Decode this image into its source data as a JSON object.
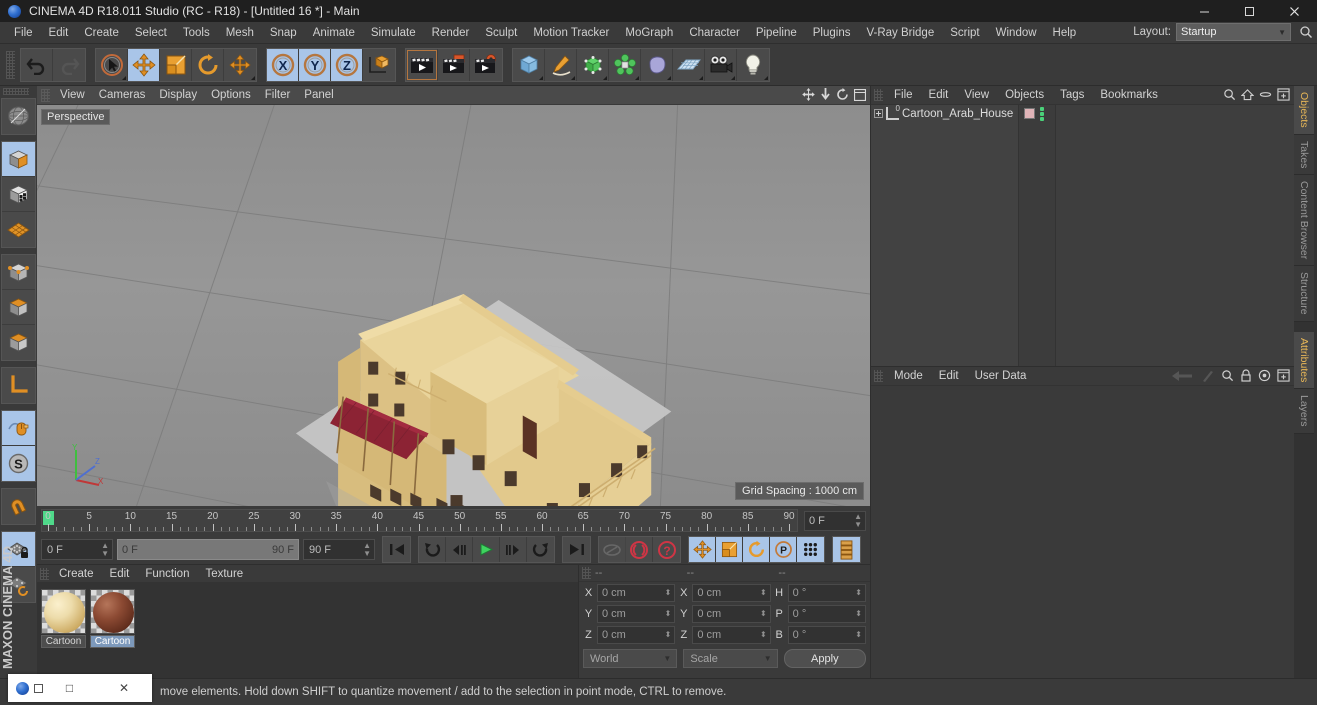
{
  "window": {
    "title": "CINEMA 4D R18.011 Studio (RC - R18) - [Untitled 16 *] - Main",
    "minimize": "─",
    "maximize": "❐",
    "close": "✕"
  },
  "menubar": {
    "items": [
      "File",
      "Edit",
      "Create",
      "Select",
      "Tools",
      "Mesh",
      "Snap",
      "Animate",
      "Simulate",
      "Render",
      "Sculpt",
      "Motion Tracker",
      "MoGraph",
      "Character",
      "Pipeline",
      "Plugins",
      "V-Ray Bridge",
      "Script",
      "Window",
      "Help"
    ],
    "layout_label": "Layout:",
    "layout_value": "Startup"
  },
  "toolbar": {
    "groups": [
      {
        "name": "history",
        "buttons": [
          {
            "name": "undo-button",
            "active": false,
            "disabled": false
          },
          {
            "name": "redo-button",
            "active": false,
            "disabled": true
          }
        ]
      },
      {
        "name": "transform",
        "buttons": [
          {
            "name": "select-tool-button",
            "active": false
          },
          {
            "name": "move-tool-button",
            "active": true
          },
          {
            "name": "scale-tool-button",
            "active": false
          },
          {
            "name": "rotate-tool-button",
            "active": false
          },
          {
            "name": "axis-tool-button",
            "active": false
          }
        ]
      },
      {
        "name": "axis-lock",
        "buttons": [
          {
            "name": "lock-x-button",
            "active": true,
            "label": "X"
          },
          {
            "name": "lock-y-button",
            "active": true,
            "label": "Y"
          },
          {
            "name": "lock-z-button",
            "active": true,
            "label": "Z"
          },
          {
            "name": "world-object-coord-button",
            "active": false
          }
        ]
      },
      {
        "name": "render",
        "buttons": [
          {
            "name": "render-view-button",
            "active": false
          },
          {
            "name": "render-to-picture-viewer-button",
            "active": false
          },
          {
            "name": "render-settings-button",
            "active": false
          }
        ]
      },
      {
        "name": "objects",
        "buttons": [
          {
            "name": "add-cube-button"
          },
          {
            "name": "add-spline-button"
          },
          {
            "name": "generators-button"
          },
          {
            "name": "deformer-button"
          },
          {
            "name": "scene-environment-button"
          },
          {
            "name": "add-floor-button"
          },
          {
            "name": "add-camera-button"
          },
          {
            "name": "add-light-button"
          }
        ]
      }
    ]
  },
  "left_tools": {
    "groups": [
      {
        "buttons": [
          {
            "name": "make-editable-button",
            "active": false
          }
        ]
      },
      {
        "buttons": [
          {
            "name": "model-mode-button",
            "active": true
          },
          {
            "name": "texture-mode-button",
            "active": false
          },
          {
            "name": "workplane-mode-button",
            "active": false
          }
        ]
      },
      {
        "buttons": [
          {
            "name": "points-mode-button",
            "active": false
          },
          {
            "name": "edges-mode-button",
            "active": false
          },
          {
            "name": "polygons-mode-button",
            "active": false
          }
        ]
      },
      {
        "buttons": [
          {
            "name": "object-axis-mode-button",
            "active": false
          }
        ]
      },
      {
        "buttons": [
          {
            "name": "enable-snap-button",
            "active": true
          },
          {
            "name": "snap-settings-button",
            "active": true
          }
        ]
      },
      {
        "buttons": [
          {
            "name": "magnet-tool-button",
            "active": false
          }
        ]
      },
      {
        "buttons": [
          {
            "name": "lock-workplane-button",
            "active": true
          },
          {
            "name": "workplane-toggle-button",
            "active": false
          }
        ]
      }
    ],
    "brand": "MAXON CINEMA 4D"
  },
  "viewport": {
    "menu": [
      "View",
      "Cameras",
      "Display",
      "Options",
      "Filter",
      "Panel"
    ],
    "label": "Perspective",
    "grid_spacing": "Grid Spacing : 1000 cm",
    "axis": {
      "x": "X",
      "y": "Y",
      "z": "Z",
      "x_color": "#d84a4a",
      "y_color": "#4ad84a",
      "z_color": "#5a7ae0"
    },
    "model": {
      "name": "Cartoon Arab House",
      "wall_color": "#e8cf96",
      "wall_shadow": "#d4b878",
      "roof_color": "#e3c88d",
      "awning_color": "#8e2436",
      "ground_color": "#c9c9c9",
      "grid_color": "#7e7e7e",
      "bg_color": "#8e8e8e"
    }
  },
  "timeline": {
    "ticks": [
      0,
      5,
      10,
      15,
      20,
      25,
      30,
      35,
      40,
      45,
      50,
      55,
      60,
      65,
      70,
      75,
      80,
      85,
      90
    ],
    "min": 0,
    "max": 90,
    "current_frame_field": "0 F",
    "playhead_frame": 0
  },
  "transport": {
    "current_frame": "0 F",
    "range_start": "0 F",
    "range_end": "90 F",
    "end_frame": "90 F",
    "buttons": [
      {
        "name": "go-to-start-button"
      },
      {
        "name": "go-to-previous-key-button"
      },
      {
        "name": "step-back-button"
      },
      {
        "name": "play-button",
        "active": false
      },
      {
        "name": "step-forward-button"
      },
      {
        "name": "go-to-next-key-button"
      },
      {
        "name": "go-to-end-button"
      },
      {
        "name": "play-forwards-sound-button",
        "disabled": true
      },
      {
        "name": "record-active-objects-button"
      },
      {
        "name": "autokeying-button"
      },
      {
        "name": "position-key-button",
        "active": true
      },
      {
        "name": "scale-key-button",
        "active": true
      },
      {
        "name": "rotation-key-button",
        "active": true
      },
      {
        "name": "parameter-key-button",
        "active": true
      },
      {
        "name": "point-level-animation-button",
        "active": true
      },
      {
        "name": "keyframe-selection-button",
        "active": true
      }
    ]
  },
  "material_manager": {
    "menu": [
      "Create",
      "Edit",
      "Function",
      "Texture"
    ],
    "materials": [
      {
        "name": "Cartoon",
        "color1": "#f2e0b0",
        "color2": "#cfae67",
        "selected": false
      },
      {
        "name": "Cartoon",
        "color1": "#a05a42",
        "color2": "#5c2a1c",
        "selected": true
      }
    ]
  },
  "coordinates": {
    "headers": [
      "--",
      "--",
      "--"
    ],
    "rows": [
      {
        "l1": "X",
        "v1": "0 cm",
        "l2": "X",
        "v2": "0 cm",
        "l3": "H",
        "v3": "0 °"
      },
      {
        "l1": "Y",
        "v1": "0 cm",
        "l2": "Y",
        "v2": "0 cm",
        "l3": "P",
        "v3": "0 °"
      },
      {
        "l1": "Z",
        "v1": "0 cm",
        "l2": "Z",
        "v2": "0 cm",
        "l3": "B",
        "v3": "0 °"
      }
    ],
    "coord_system": "World",
    "size_mode": "Scale",
    "apply": "Apply"
  },
  "object_manager": {
    "menu": [
      "File",
      "Edit",
      "View",
      "Objects",
      "Tags",
      "Bookmarks"
    ],
    "objects": [
      {
        "name": "Cartoon_Arab_House",
        "tag_color": "#e0b4b8",
        "level": 0
      }
    ]
  },
  "attribute_manager": {
    "menu": [
      "Mode",
      "Edit",
      "User Data"
    ]
  },
  "right_tabs": {
    "top": [
      "Objects",
      "Takes",
      "Content Browser",
      "Structure"
    ],
    "bottom": [
      "Attributes",
      "Layers"
    ],
    "active_top": "Objects",
    "active_bottom": "Attributes"
  },
  "statusbar": {
    "message": "move elements. Hold down SHIFT to quantize movement / add to the selection in point mode, CTRL to remove."
  },
  "overlay_window": {
    "minimize": "─",
    "maximize": "□",
    "close": "✕"
  }
}
